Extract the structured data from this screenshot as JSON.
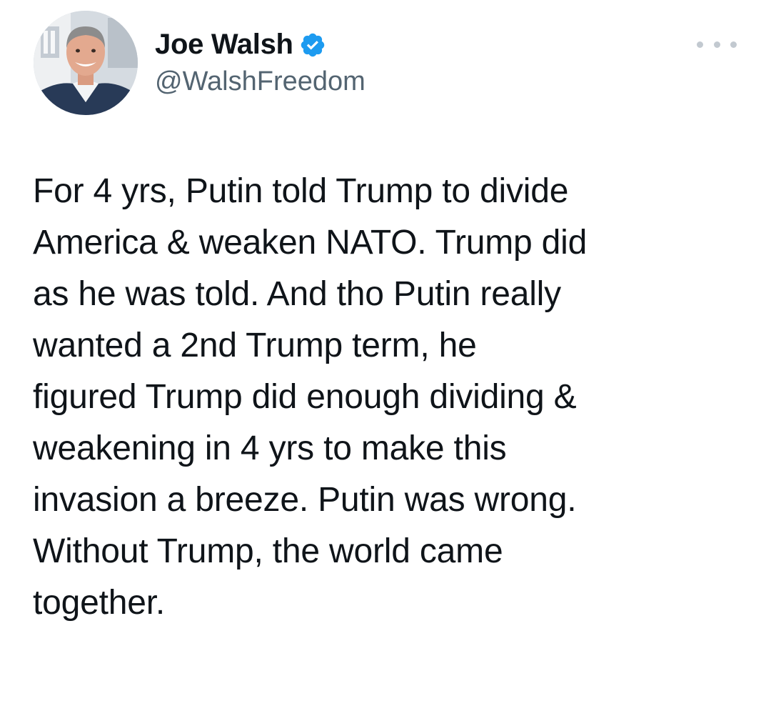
{
  "author": {
    "display_name": "Joe Walsh",
    "handle": "@WalshFreedom",
    "verified": true,
    "avatar_icon": "profile-photo"
  },
  "menu": {
    "icon": "more-options-icon"
  },
  "tweet": {
    "lines": [
      "For 4 yrs, Putin told Trump to divide",
      "America & weaken NATO. Trump did",
      "as he was told. And tho Putin really",
      "wanted a 2nd Trump term, he",
      "figured Trump did enough dividing &",
      "weakening in 4 yrs to make this",
      "invasion a breeze. Putin was wrong.",
      "Without Trump, the world came",
      "together."
    ]
  },
  "colors": {
    "text": "#0f1419",
    "secondary": "#536471",
    "verified": "#1d9bf0",
    "background": "#ffffff"
  }
}
